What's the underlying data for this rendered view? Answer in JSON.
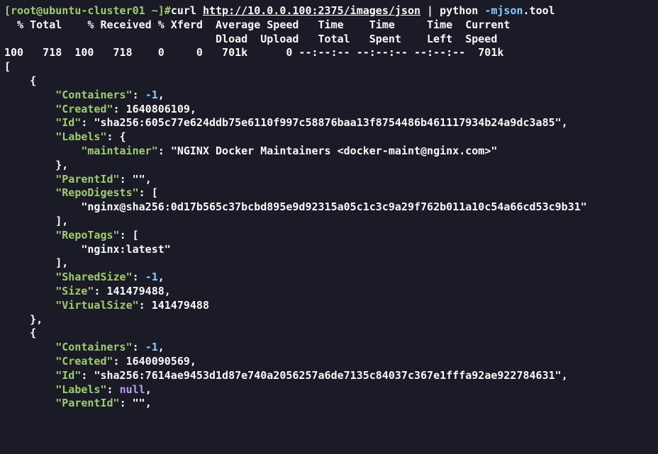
{
  "prompt": {
    "user_host": "[root@ubuntu-cluster01 ~]#",
    "cmd_curl": "curl ",
    "url": "http://10.0.0.100:2375/images/json",
    "pipe": " | python ",
    "flag": "-mjson",
    "tool": ".tool"
  },
  "curl_header1": "  % Total    % Received % Xferd  Average Speed   Time    Time     Time  Current",
  "curl_header2": "                                 Dload  Upload   Total   Spent    Left  Speed",
  "curl_progress": "100   718  100   718    0     0   701k      0 --:--:-- --:--:-- --:--:--  701k",
  "json": {
    "open_bracket": "[",
    "obj1_open": "    {",
    "containers": {
      "key": "\"Containers\"",
      "val": "-1"
    },
    "created1": {
      "key": "\"Created\"",
      "val": "1640806109"
    },
    "id1": {
      "key": "\"Id\"",
      "val": "\"sha256:605c77e624ddb75e6110f997c58876baa13f8754486b461117934b24a9dc3a85\""
    },
    "labels": {
      "key": "\"Labels\"",
      "open": "{"
    },
    "maintainer": {
      "key": "\"maintainer\"",
      "val": "\"NGINX Docker Maintainers <docker-maint@nginx.com>\""
    },
    "labels_close": "        },",
    "parentid1": {
      "key": "\"ParentId\"",
      "val": "\"\""
    },
    "repodigests": {
      "key": "\"RepoDigests\"",
      "open": "["
    },
    "digest1": "\"nginx@sha256:0d17b565c37bcbd895e9d92315a05c1c3c9a29f762b011a10c54a66cd53c9b31\"",
    "repodigests_close": "        ],",
    "repotags": {
      "key": "\"RepoTags\"",
      "open": "["
    },
    "tag1": "\"nginx:latest\"",
    "repotags_close": "        ],",
    "sharedsize": {
      "key": "\"SharedSize\"",
      "val": "-1"
    },
    "size": {
      "key": "\"Size\"",
      "val": "141479488"
    },
    "virtualsize": {
      "key": "\"VirtualSize\"",
      "val": "141479488"
    },
    "obj1_close": "    },",
    "obj2_open": "    {",
    "containers2": {
      "key": "\"Containers\"",
      "val": "-1"
    },
    "created2": {
      "key": "\"Created\"",
      "val": "1640090569"
    },
    "id2": {
      "key": "\"Id\"",
      "val": "\"sha256:7614ae9453d1d87e740a2056257a6de7135c84037c367e1fffa92ae922784631\""
    },
    "labels2": {
      "key": "\"Labels\"",
      "val": "null"
    },
    "parentid2": {
      "key": "\"ParentId\"",
      "val": "\"\""
    }
  }
}
